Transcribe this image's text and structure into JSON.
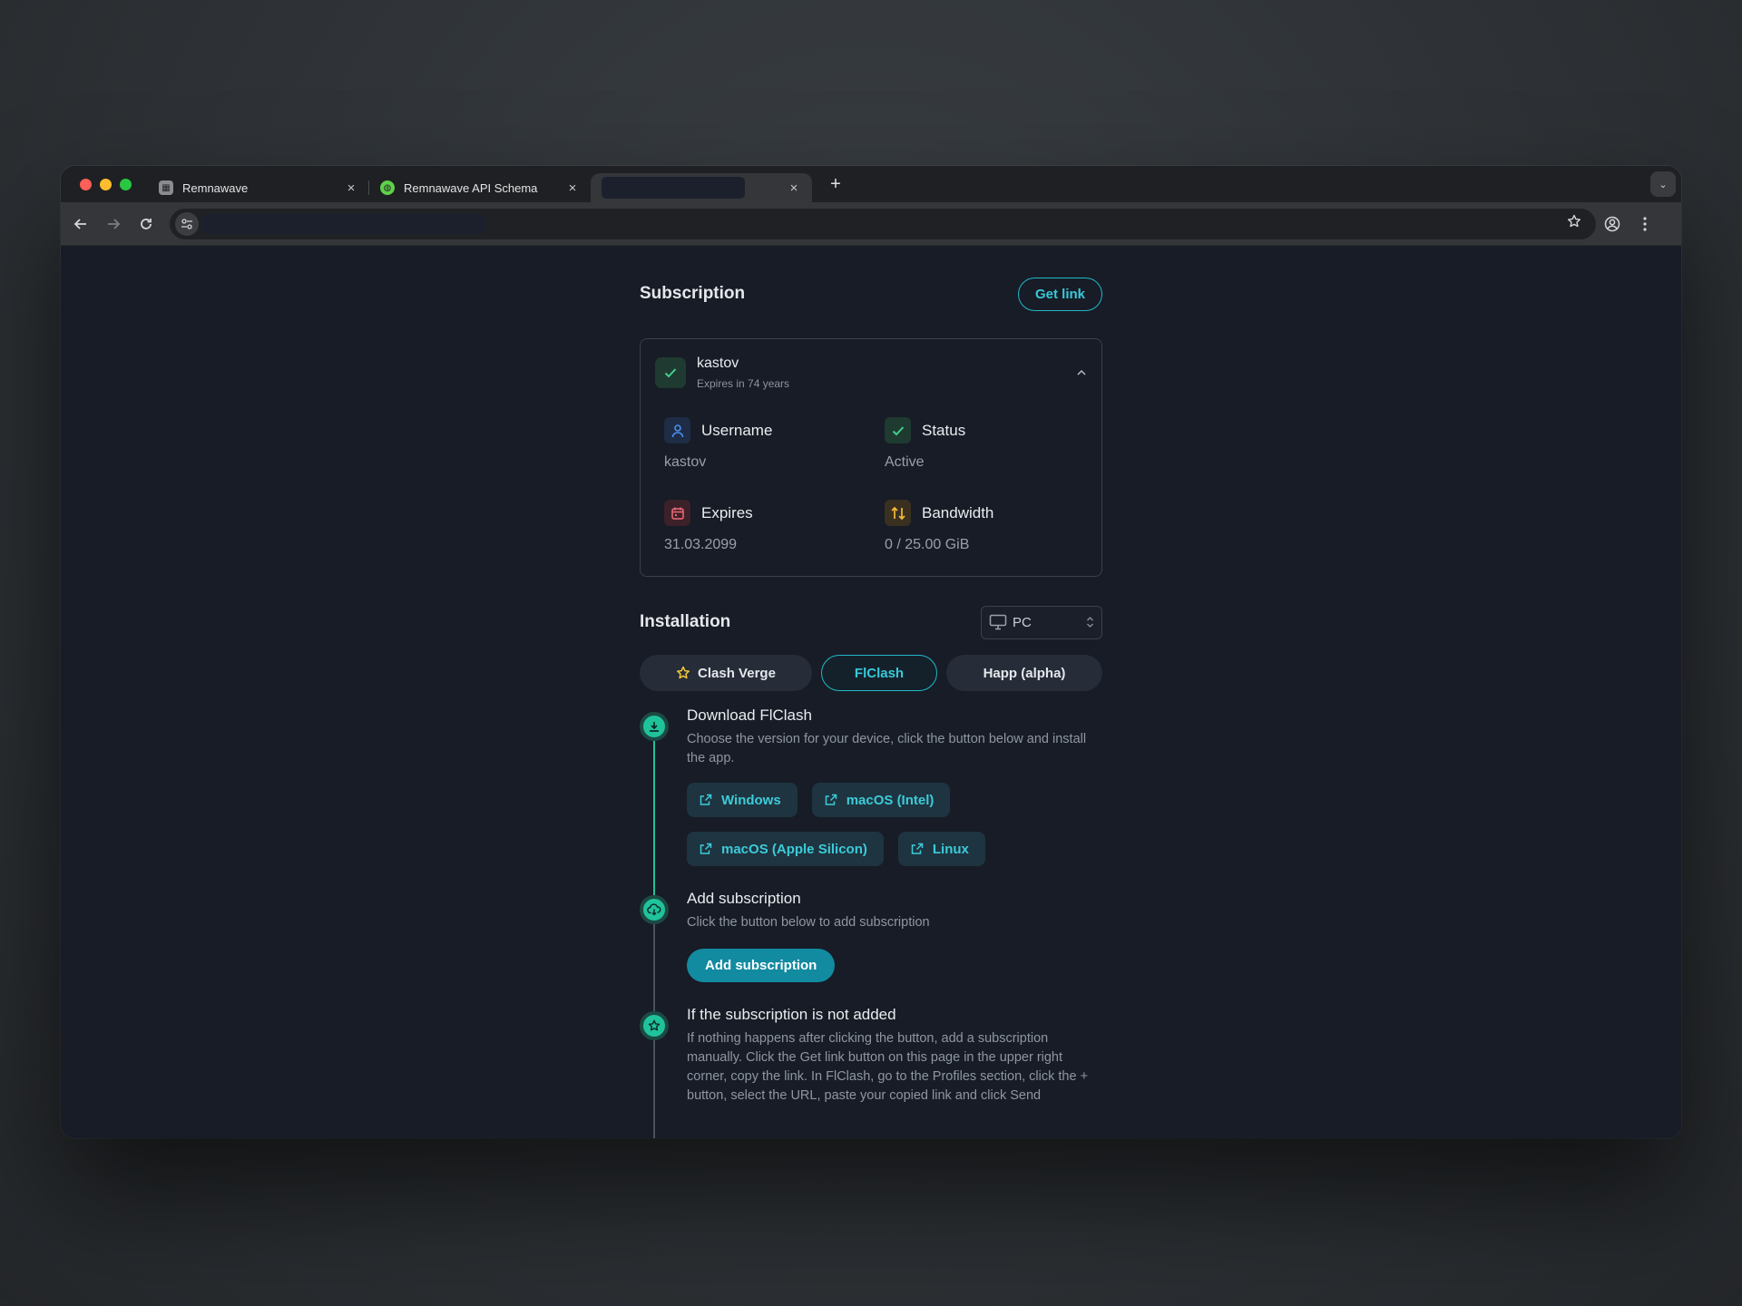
{
  "browser": {
    "tabs": [
      {
        "title": "Remnawave",
        "close": "×"
      },
      {
        "title": "Remnawave API Schema",
        "close": "×"
      },
      {
        "title": "",
        "close": "×"
      }
    ],
    "new_tab": "+",
    "tab_menu": "⌄"
  },
  "subscription": {
    "title": "Subscription",
    "get_link_label": "Get link",
    "user": {
      "name": "kastov",
      "expires_relative": "Expires in 74 years"
    },
    "fields": {
      "username": {
        "label": "Username",
        "value": "kastov"
      },
      "status": {
        "label": "Status",
        "value": "Active"
      },
      "expires": {
        "label": "Expires",
        "value": "31.03.2099"
      },
      "bandwidth": {
        "label": "Bandwidth",
        "value": "0 / 25.00 GiB"
      }
    }
  },
  "installation": {
    "title": "Installation",
    "platform_select": {
      "value": "PC"
    },
    "apps": [
      {
        "label": "Clash Verge",
        "selected": false,
        "featured": true
      },
      {
        "label": "FlClash",
        "selected": true
      },
      {
        "label": "Happ (alpha)",
        "selected": false
      }
    ],
    "steps": [
      {
        "title": "Download FlClash",
        "description": "Choose the version for your device, click the button below and install the app.",
        "buttons": [
          "Windows",
          "macOS (Intel)",
          "macOS (Apple Silicon)",
          "Linux"
        ]
      },
      {
        "title": "Add subscription",
        "description": "Click the button below to add subscription",
        "button": "Add subscription"
      },
      {
        "title": "If the subscription is not added",
        "description": "If nothing happens after clicking the button, add a subscription manually. Click the Get link button on this page in the upper right corner, copy the link. In FlClash, go to the Profiles section, click the + button, select the URL, paste your copied link and click Send"
      }
    ]
  },
  "colors": {
    "accent": "#22b8c9",
    "success": "#1fc39b",
    "page_bg": "#171c26"
  }
}
